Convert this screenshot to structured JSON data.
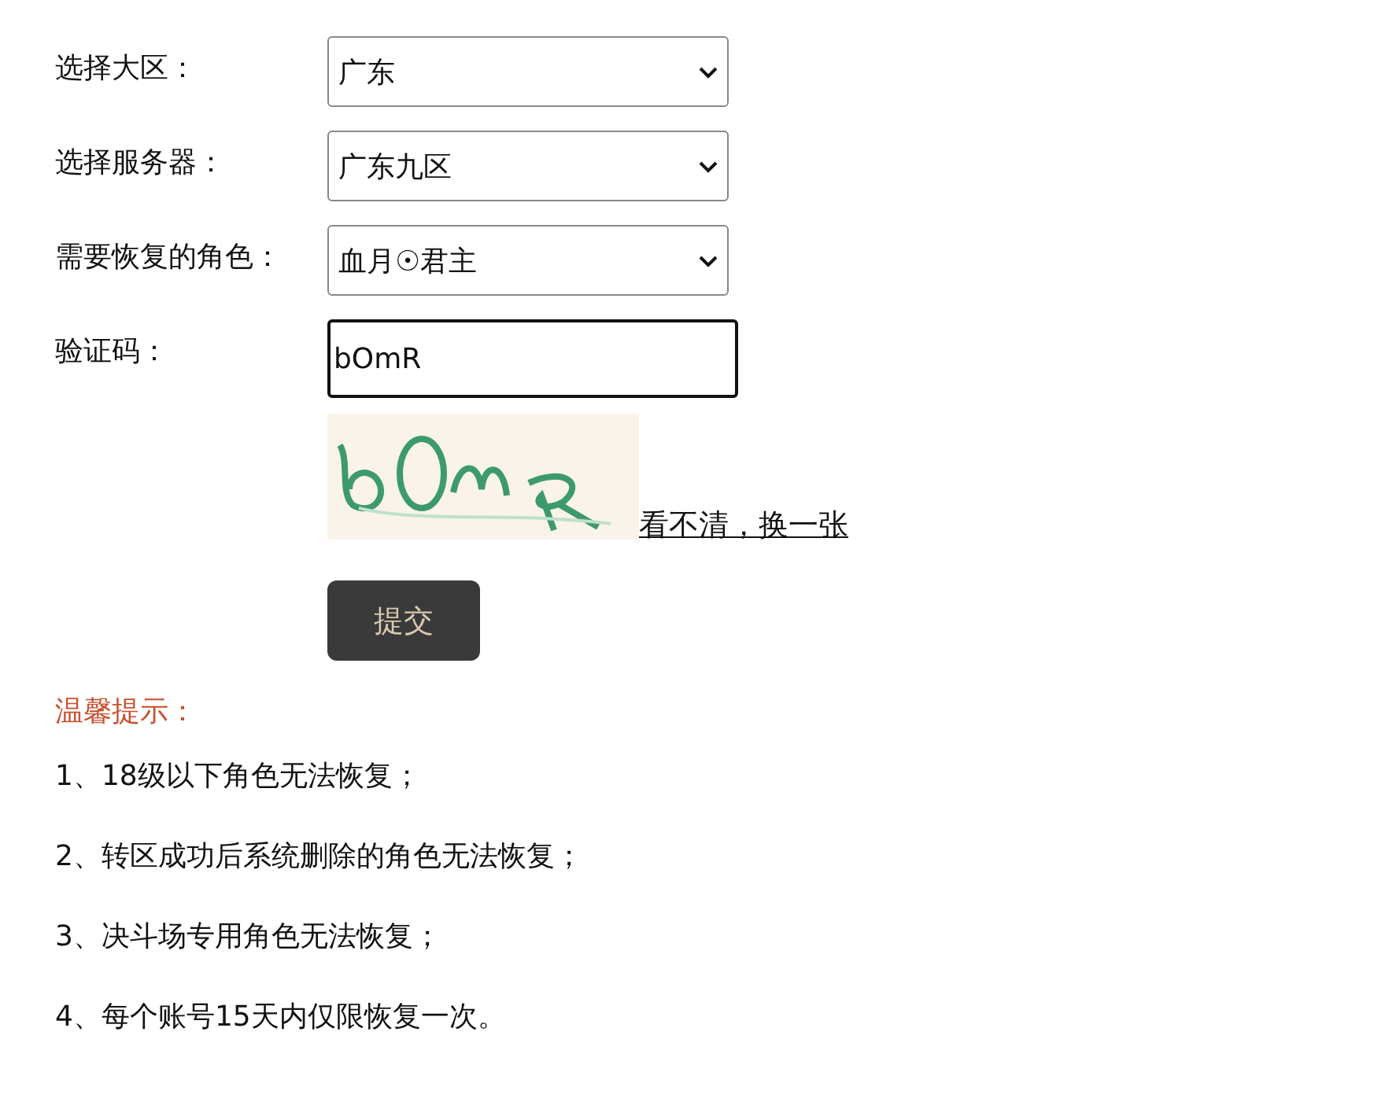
{
  "form": {
    "fields": [
      {
        "kind": "select",
        "label": "选择大区：",
        "value": "广东"
      },
      {
        "kind": "select",
        "label": "选择服务器：",
        "value": "广东九区"
      },
      {
        "kind": "select",
        "label": "需要恢复的角色：",
        "value": "血月☉君主"
      },
      {
        "kind": "input",
        "label": "验证码：",
        "value": "bOmR",
        "focused": true
      }
    ],
    "captcha": {
      "kind": "picture",
      "refresh_link": "看不清，换一张"
    },
    "submit_button": "提交"
  },
  "tips": {
    "title": "温馨提示：",
    "items": [
      "1、18级以下角色无法恢复；",
      "2、转区成功后系统删除的角色无法恢复；",
      "3、决斗场专用角色无法恢复；",
      "4、每个账号15天内仅限恢复一次。"
    ]
  }
}
